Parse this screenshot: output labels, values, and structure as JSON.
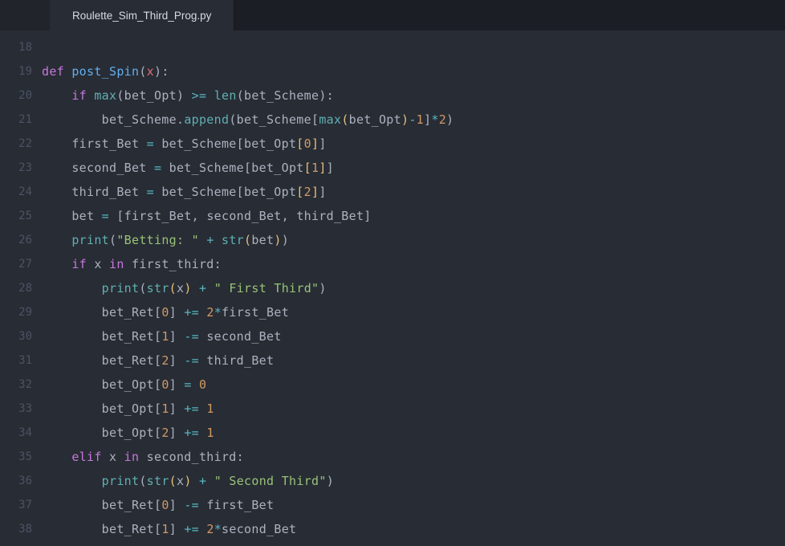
{
  "tab": {
    "filename": "Roulette_Sim_Third_Prog.py"
  },
  "gutter": {
    "start": 18,
    "end": 38
  },
  "code": {
    "lines": [
      {
        "n": 18,
        "tokens": []
      },
      {
        "n": 19,
        "tokens": [
          {
            "c": "kw",
            "t": "def "
          },
          {
            "c": "fn",
            "t": "post_Spin"
          },
          {
            "c": "punc",
            "t": "("
          },
          {
            "c": "self",
            "t": "x"
          },
          {
            "c": "punc",
            "t": "):"
          }
        ]
      },
      {
        "n": 20,
        "indent": 1,
        "tokens": [
          {
            "c": "kw",
            "t": "if "
          },
          {
            "c": "call",
            "t": "max"
          },
          {
            "c": "punc",
            "t": "("
          },
          {
            "c": "id",
            "t": "bet_Opt"
          },
          {
            "c": "punc",
            "t": ") "
          },
          {
            "c": "op",
            "t": ">="
          },
          {
            "c": "punc",
            "t": " "
          },
          {
            "c": "call",
            "t": "len"
          },
          {
            "c": "punc",
            "t": "("
          },
          {
            "c": "id",
            "t": "bet_Scheme"
          },
          {
            "c": "punc",
            "t": "):"
          }
        ]
      },
      {
        "n": 21,
        "indent": 2,
        "tokens": [
          {
            "c": "id",
            "t": "bet_Scheme"
          },
          {
            "c": "punc",
            "t": "."
          },
          {
            "c": "call",
            "t": "append"
          },
          {
            "c": "punc",
            "t": "("
          },
          {
            "c": "id",
            "t": "bet_Scheme"
          },
          {
            "c": "punc",
            "t": "["
          },
          {
            "c": "call",
            "t": "max"
          },
          {
            "c": "par",
            "t": "("
          },
          {
            "c": "id",
            "t": "bet_Opt"
          },
          {
            "c": "par",
            "t": ")"
          },
          {
            "c": "op",
            "t": "-"
          },
          {
            "c": "num",
            "t": "1"
          },
          {
            "c": "punc",
            "t": "]"
          },
          {
            "c": "op",
            "t": "*"
          },
          {
            "c": "num",
            "t": "2"
          },
          {
            "c": "punc",
            "t": ")"
          }
        ]
      },
      {
        "n": 22,
        "indent": 1,
        "tokens": [
          {
            "c": "id",
            "t": "first_Bet "
          },
          {
            "c": "op",
            "t": "="
          },
          {
            "c": "id",
            "t": " bet_Scheme"
          },
          {
            "c": "punc",
            "t": "["
          },
          {
            "c": "id",
            "t": "bet_Opt"
          },
          {
            "c": "par",
            "t": "["
          },
          {
            "c": "num",
            "t": "0"
          },
          {
            "c": "par",
            "t": "]"
          },
          {
            "c": "punc",
            "t": "]"
          }
        ]
      },
      {
        "n": 23,
        "indent": 1,
        "tokens": [
          {
            "c": "id",
            "t": "second_Bet "
          },
          {
            "c": "op",
            "t": "="
          },
          {
            "c": "id",
            "t": " bet_Scheme"
          },
          {
            "c": "punc",
            "t": "["
          },
          {
            "c": "id",
            "t": "bet_Opt"
          },
          {
            "c": "par",
            "t": "["
          },
          {
            "c": "num",
            "t": "1"
          },
          {
            "c": "par",
            "t": "]"
          },
          {
            "c": "punc",
            "t": "]"
          }
        ]
      },
      {
        "n": 24,
        "indent": 1,
        "tokens": [
          {
            "c": "id",
            "t": "third_Bet "
          },
          {
            "c": "op",
            "t": "="
          },
          {
            "c": "id",
            "t": " bet_Scheme"
          },
          {
            "c": "punc",
            "t": "["
          },
          {
            "c": "id",
            "t": "bet_Opt"
          },
          {
            "c": "par",
            "t": "["
          },
          {
            "c": "num",
            "t": "2"
          },
          {
            "c": "par",
            "t": "]"
          },
          {
            "c": "punc",
            "t": "]"
          }
        ]
      },
      {
        "n": 25,
        "indent": 1,
        "tokens": [
          {
            "c": "id",
            "t": "bet "
          },
          {
            "c": "op",
            "t": "="
          },
          {
            "c": "punc",
            "t": " ["
          },
          {
            "c": "id",
            "t": "first_Bet"
          },
          {
            "c": "punc",
            "t": ", "
          },
          {
            "c": "id",
            "t": "second_Bet"
          },
          {
            "c": "punc",
            "t": ", "
          },
          {
            "c": "id",
            "t": "third_Bet"
          },
          {
            "c": "punc",
            "t": "]"
          }
        ]
      },
      {
        "n": 26,
        "indent": 1,
        "tokens": [
          {
            "c": "call",
            "t": "print"
          },
          {
            "c": "punc",
            "t": "("
          },
          {
            "c": "str",
            "t": "\"Betting: \""
          },
          {
            "c": "punc",
            "t": " "
          },
          {
            "c": "op",
            "t": "+"
          },
          {
            "c": "punc",
            "t": " "
          },
          {
            "c": "call",
            "t": "str"
          },
          {
            "c": "par",
            "t": "("
          },
          {
            "c": "id",
            "t": "bet"
          },
          {
            "c": "par",
            "t": ")"
          },
          {
            "c": "punc",
            "t": ")"
          }
        ]
      },
      {
        "n": 27,
        "indent": 1,
        "tokens": [
          {
            "c": "kw",
            "t": "if "
          },
          {
            "c": "id",
            "t": "x "
          },
          {
            "c": "kw",
            "t": "in "
          },
          {
            "c": "id",
            "t": "first_third"
          },
          {
            "c": "punc",
            "t": ":"
          }
        ]
      },
      {
        "n": 28,
        "indent": 2,
        "tokens": [
          {
            "c": "call",
            "t": "print"
          },
          {
            "c": "punc",
            "t": "("
          },
          {
            "c": "call",
            "t": "str"
          },
          {
            "c": "par",
            "t": "("
          },
          {
            "c": "id",
            "t": "x"
          },
          {
            "c": "par",
            "t": ")"
          },
          {
            "c": "punc",
            "t": " "
          },
          {
            "c": "op",
            "t": "+"
          },
          {
            "c": "punc",
            "t": " "
          },
          {
            "c": "str",
            "t": "\" First Third\""
          },
          {
            "c": "punc",
            "t": ")"
          }
        ]
      },
      {
        "n": 29,
        "indent": 2,
        "tokens": [
          {
            "c": "id",
            "t": "bet_Ret"
          },
          {
            "c": "punc",
            "t": "["
          },
          {
            "c": "num",
            "t": "0"
          },
          {
            "c": "punc",
            "t": "] "
          },
          {
            "c": "op",
            "t": "+="
          },
          {
            "c": "punc",
            "t": " "
          },
          {
            "c": "num",
            "t": "2"
          },
          {
            "c": "op",
            "t": "*"
          },
          {
            "c": "id",
            "t": "first_Bet"
          }
        ]
      },
      {
        "n": 30,
        "indent": 2,
        "tokens": [
          {
            "c": "id",
            "t": "bet_Ret"
          },
          {
            "c": "punc",
            "t": "["
          },
          {
            "c": "num",
            "t": "1"
          },
          {
            "c": "punc",
            "t": "] "
          },
          {
            "c": "op",
            "t": "-="
          },
          {
            "c": "id",
            "t": " second_Bet"
          }
        ]
      },
      {
        "n": 31,
        "indent": 2,
        "tokens": [
          {
            "c": "id",
            "t": "bet_Ret"
          },
          {
            "c": "punc",
            "t": "["
          },
          {
            "c": "num",
            "t": "2"
          },
          {
            "c": "punc",
            "t": "] "
          },
          {
            "c": "op",
            "t": "-="
          },
          {
            "c": "id",
            "t": " third_Bet"
          }
        ]
      },
      {
        "n": 32,
        "indent": 2,
        "tokens": [
          {
            "c": "id",
            "t": "bet_Opt"
          },
          {
            "c": "punc",
            "t": "["
          },
          {
            "c": "num",
            "t": "0"
          },
          {
            "c": "punc",
            "t": "] "
          },
          {
            "c": "op",
            "t": "="
          },
          {
            "c": "punc",
            "t": " "
          },
          {
            "c": "num",
            "t": "0"
          }
        ]
      },
      {
        "n": 33,
        "indent": 2,
        "tokens": [
          {
            "c": "id",
            "t": "bet_Opt"
          },
          {
            "c": "punc",
            "t": "["
          },
          {
            "c": "num",
            "t": "1"
          },
          {
            "c": "punc",
            "t": "] "
          },
          {
            "c": "op",
            "t": "+="
          },
          {
            "c": "punc",
            "t": " "
          },
          {
            "c": "num",
            "t": "1"
          }
        ]
      },
      {
        "n": 34,
        "indent": 2,
        "tokens": [
          {
            "c": "id",
            "t": "bet_Opt"
          },
          {
            "c": "punc",
            "t": "["
          },
          {
            "c": "num",
            "t": "2"
          },
          {
            "c": "punc",
            "t": "] "
          },
          {
            "c": "op",
            "t": "+="
          },
          {
            "c": "punc",
            "t": " "
          },
          {
            "c": "num",
            "t": "1"
          }
        ]
      },
      {
        "n": 35,
        "indent": 1,
        "tokens": [
          {
            "c": "kw",
            "t": "elif "
          },
          {
            "c": "id",
            "t": "x "
          },
          {
            "c": "kw",
            "t": "in "
          },
          {
            "c": "id",
            "t": "second_third"
          },
          {
            "c": "punc",
            "t": ":"
          }
        ]
      },
      {
        "n": 36,
        "indent": 2,
        "tokens": [
          {
            "c": "call",
            "t": "print"
          },
          {
            "c": "punc",
            "t": "("
          },
          {
            "c": "call",
            "t": "str"
          },
          {
            "c": "par",
            "t": "("
          },
          {
            "c": "id",
            "t": "x"
          },
          {
            "c": "par",
            "t": ")"
          },
          {
            "c": "punc",
            "t": " "
          },
          {
            "c": "op",
            "t": "+"
          },
          {
            "c": "punc",
            "t": " "
          },
          {
            "c": "str",
            "t": "\" Second Third\""
          },
          {
            "c": "punc",
            "t": ")"
          }
        ]
      },
      {
        "n": 37,
        "indent": 2,
        "tokens": [
          {
            "c": "id",
            "t": "bet_Ret"
          },
          {
            "c": "punc",
            "t": "["
          },
          {
            "c": "num",
            "t": "0"
          },
          {
            "c": "punc",
            "t": "] "
          },
          {
            "c": "op",
            "t": "-="
          },
          {
            "c": "id",
            "t": " first_Bet"
          }
        ]
      },
      {
        "n": 38,
        "indent": 2,
        "tokens": [
          {
            "c": "id",
            "t": "bet_Ret"
          },
          {
            "c": "punc",
            "t": "["
          },
          {
            "c": "num",
            "t": "1"
          },
          {
            "c": "punc",
            "t": "] "
          },
          {
            "c": "op",
            "t": "+="
          },
          {
            "c": "punc",
            "t": " "
          },
          {
            "c": "num",
            "t": "2"
          },
          {
            "c": "op",
            "t": "*"
          },
          {
            "c": "id",
            "t": "second_Bet"
          }
        ]
      }
    ]
  }
}
